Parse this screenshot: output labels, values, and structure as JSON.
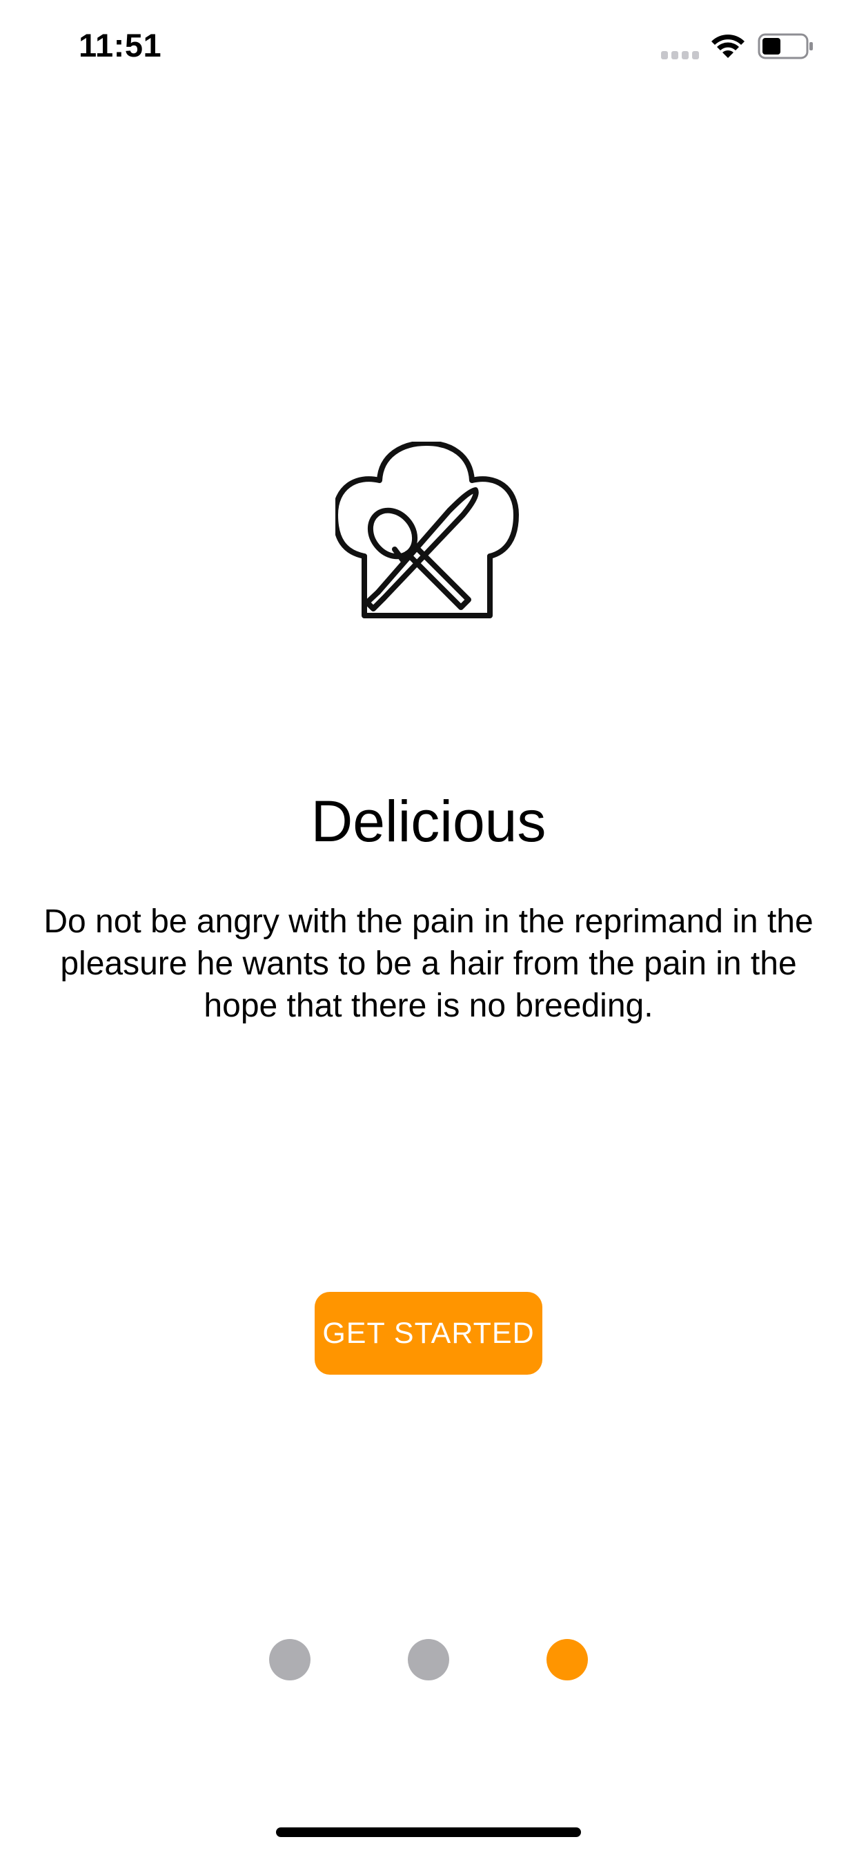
{
  "status_bar": {
    "time": "11:51",
    "icons": [
      "signal-dots-icon",
      "wifi-icon",
      "battery-icon"
    ]
  },
  "onboarding": {
    "icon": "chef-hat-utensils-icon",
    "title": "Delicious",
    "description": "Do not be angry with the pain in the reprimand in the pleasure he wants to be a hair from the pain in the hope that there is no breeding.",
    "button_label": "GET STARTED"
  },
  "pagination": {
    "total_pages": 3,
    "current_page": 3,
    "inactive_color": "#aeaeb2",
    "active_color": "#ff9500"
  },
  "colors": {
    "accent": "#ff9500",
    "background": "#ffffff",
    "text": "#000000"
  }
}
